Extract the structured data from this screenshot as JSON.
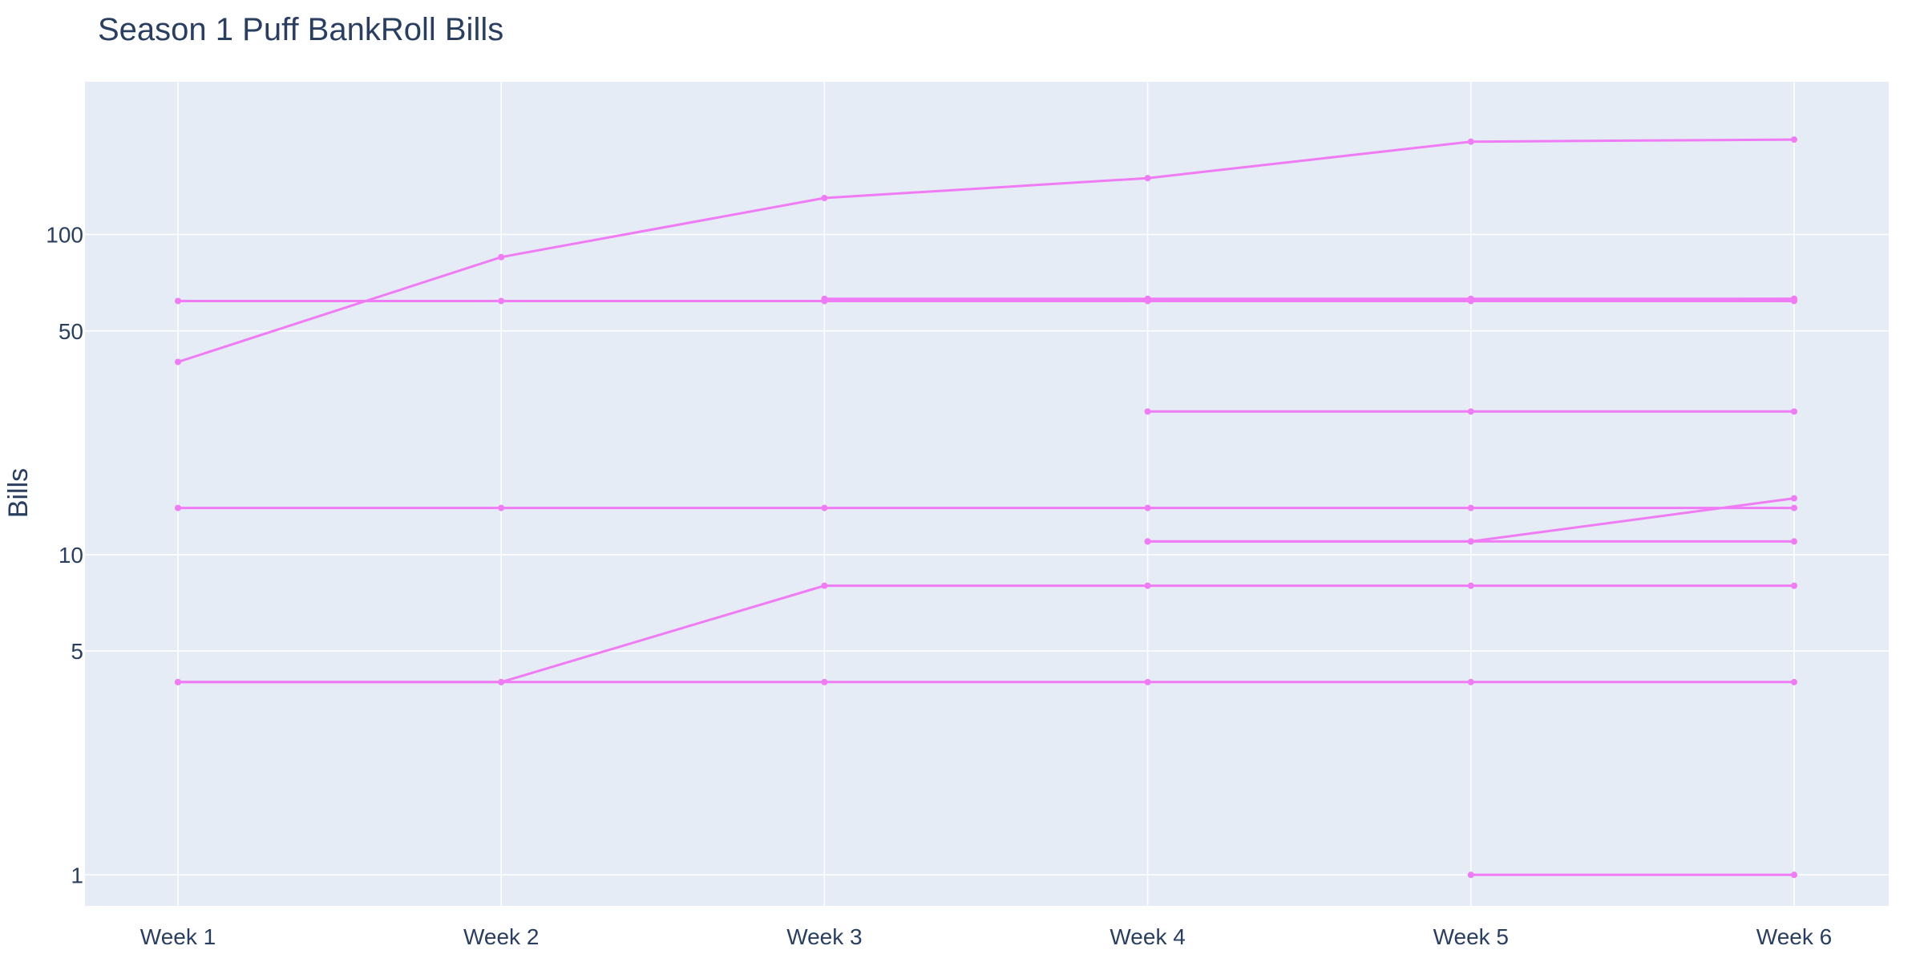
{
  "chart_data": {
    "type": "line",
    "title": "Season 1 Puff BankRoll Bills",
    "xlabel": "",
    "ylabel": "Bills",
    "y_scale": "log",
    "ylim": [
      0.8,
      300
    ],
    "y_ticks": [
      1,
      5,
      10,
      50,
      100
    ],
    "categories": [
      "Week 1",
      "Week 2",
      "Week 3",
      "Week 4",
      "Week 5",
      "Week 6"
    ],
    "grid": true,
    "colors": {
      "line": "#ef7cf4",
      "plot_bg": "#e5ecf6",
      "grid": "#ffffff",
      "text": "#2a3f5f"
    },
    "series": [
      {
        "values": [
          40,
          85,
          130,
          150,
          195,
          198
        ]
      },
      {
        "values": [
          62,
          62,
          62,
          62,
          62,
          62
        ]
      },
      {
        "values": [
          null,
          null,
          63,
          63,
          63,
          63
        ]
      },
      {
        "values": [
          null,
          null,
          62,
          62.5,
          62.5,
          63
        ]
      },
      {
        "values": [
          14,
          14,
          14,
          14,
          14,
          14
        ]
      },
      {
        "values": [
          4,
          4,
          8,
          8,
          8,
          8
        ]
      },
      {
        "values": [
          4,
          4,
          4,
          4,
          4,
          4
        ]
      },
      {
        "values": [
          null,
          null,
          null,
          28,
          28,
          28
        ]
      },
      {
        "values": [
          null,
          null,
          null,
          11,
          11,
          11
        ]
      },
      {
        "values": [
          null,
          null,
          null,
          11,
          11,
          15
        ]
      },
      {
        "values": [
          null,
          null,
          null,
          null,
          1,
          1
        ]
      }
    ]
  }
}
